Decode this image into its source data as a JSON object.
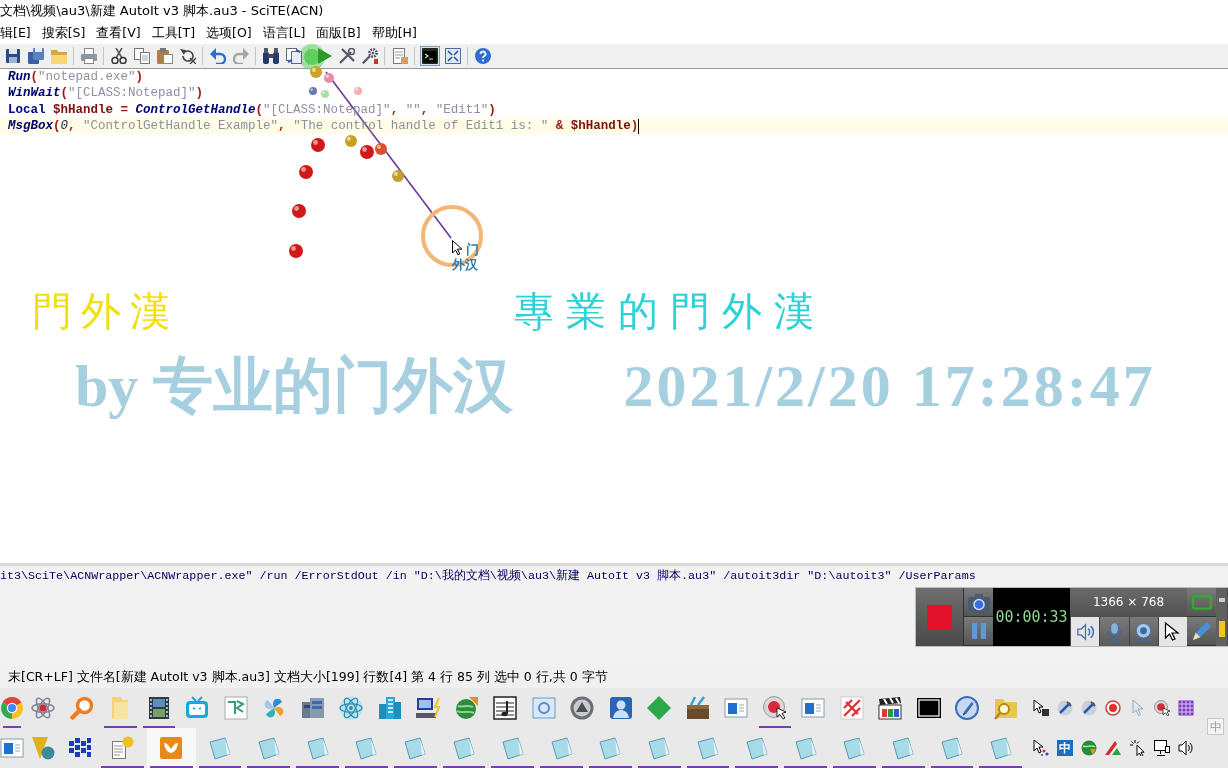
{
  "window": {
    "title": "文档\\视频\\au3\\新建 AutoIt v3 脚本.au3 - SciTE(ACN)"
  },
  "menu": [
    "辑[E]",
    "搜索[S]",
    "查看[V]",
    "工具[T]",
    "选项[O]",
    "语言[L]",
    "面版[B]",
    "帮助[H]"
  ],
  "toolbar": {
    "groups": [
      [
        {
          "kind": "save",
          "pressed": false,
          "disabled": false
        },
        {
          "kind": "saveall",
          "pressed": false,
          "disabled": false
        },
        {
          "kind": "open",
          "pressed": false,
          "disabled": false
        }
      ],
      [
        {
          "kind": "print",
          "pressed": false,
          "disabled": false
        }
      ],
      [
        {
          "kind": "cut",
          "pressed": false,
          "disabled": false
        },
        {
          "kind": "copy",
          "pressed": false,
          "disabled": false
        },
        {
          "kind": "paste",
          "pressed": false,
          "disabled": false
        },
        {
          "kind": "revert",
          "pressed": false,
          "disabled": false
        }
      ],
      [
        {
          "kind": "undo",
          "pressed": false,
          "disabled": false
        },
        {
          "kind": "redo",
          "pressed": false,
          "disabled": true
        }
      ],
      [
        {
          "kind": "find",
          "pressed": false,
          "disabled": false
        },
        {
          "kind": "replace",
          "pressed": false,
          "disabled": false
        }
      ],
      [
        {
          "kind": "run",
          "pressed": false,
          "disabled": false
        },
        {
          "kind": "compile",
          "pressed": false,
          "disabled": false
        },
        {
          "kind": "build",
          "pressed": false,
          "disabled": false
        }
      ],
      [
        {
          "kind": "properties",
          "pressed": false,
          "disabled": false
        }
      ],
      [
        {
          "kind": "console",
          "pressed": true,
          "disabled": false
        },
        {
          "kind": "fullscreen",
          "pressed": false,
          "disabled": false
        }
      ],
      [
        {
          "kind": "help",
          "pressed": false,
          "disabled": false
        }
      ]
    ]
  },
  "editor": {
    "lines": [
      {
        "current": false,
        "tokens": [
          {
            "kind": "func",
            "text": "Run"
          },
          {
            "kind": "op",
            "text": "("
          },
          {
            "kind": "str",
            "text": "\"notepad.exe\""
          },
          {
            "kind": "op",
            "text": ")"
          }
        ]
      },
      {
        "current": false,
        "tokens": [
          {
            "kind": "func",
            "text": "WinWait"
          },
          {
            "kind": "op",
            "text": "("
          },
          {
            "kind": "str",
            "text": "\"[CLASS:Notepad]\""
          },
          {
            "kind": "op",
            "text": ")"
          }
        ]
      },
      {
        "current": false,
        "tokens": [
          {
            "kind": "kw",
            "text": "Local "
          },
          {
            "kind": "var",
            "text": "$hHandle"
          },
          {
            "kind": "op",
            "text": " = "
          },
          {
            "kind": "func",
            "text": "ControlGetHandle"
          },
          {
            "kind": "op",
            "text": "("
          },
          {
            "kind": "str",
            "text": "\"[CLASS:Notepad]\""
          },
          {
            "kind": "op",
            "text": ", "
          },
          {
            "kind": "str",
            "text": "\"\""
          },
          {
            "kind": "op",
            "text": ", "
          },
          {
            "kind": "str",
            "text": "\"Edit1\""
          },
          {
            "kind": "op",
            "text": ")"
          }
        ]
      },
      {
        "current": true,
        "tokens": [
          {
            "kind": "func",
            "text": "MsgBox"
          },
          {
            "kind": "op",
            "text": "("
          },
          {
            "kind": "num",
            "text": "0"
          },
          {
            "kind": "op",
            "text": ", "
          },
          {
            "kind": "str",
            "text": "\"ControlGetHandle Example\""
          },
          {
            "kind": "op",
            "text": ", "
          },
          {
            "kind": "str",
            "text": "\"The control handle of Edit1 is: \""
          },
          {
            "kind": "op",
            "text": " & "
          },
          {
            "kind": "var",
            "text": "$hHandle"
          },
          {
            "kind": "op",
            "text": ")"
          }
        ]
      }
    ]
  },
  "overlay": {
    "calligraphy": [
      {
        "text": "門外漢",
        "color": "#f0e010"
      },
      {
        "text": "專業的門外漢",
        "color": "#2ed2d6"
      }
    ],
    "caption": [
      "by 专业的门外汉",
      "2021/2/20 17:28:47"
    ],
    "cursor_label": [
      "门",
      "外汉"
    ]
  },
  "output": {
    "lines": [
      "it3\\SciTe\\ACNWrapper\\ACNWrapper.exe\" /run /ErrorStdOut /in \"D:\\我的文档\\视频\\au3\\新建 AutoIt v3 脚本.au3\" /autoit3dir \"D:\\autoit3\" /UserParams"
    ]
  },
  "recorder": {
    "timer": "00:00:33",
    "resolution": "1366 × 768",
    "toggles": [
      {
        "kind": "speaker",
        "on": true
      },
      {
        "kind": "microphone",
        "on": false
      },
      {
        "kind": "webcam",
        "on": false
      },
      {
        "kind": "cursor",
        "on": true
      }
    ]
  },
  "status_bar": "末[CR+LF] 文件名[新建 AutoIt v3 脚本.au3] 文档大小[199] 行数[4] 第 4 行 85 列 选中 0 行,共 0 字节",
  "taskbar": {
    "rows": [
      {
        "apps": [
          {
            "kind": "wheel",
            "running": true,
            "active": false
          },
          {
            "kind": "orbit",
            "running": false,
            "active": false
          },
          {
            "kind": "magnifier",
            "running": false,
            "active": false
          },
          {
            "kind": "folder",
            "running": true,
            "active": false
          },
          {
            "kind": "filmstrip",
            "running": true,
            "active": false
          },
          {
            "kind": "tv",
            "running": false,
            "active": false
          },
          {
            "kind": "tile",
            "running": false,
            "active": false
          },
          {
            "kind": "pinwheel",
            "running": false,
            "active": false
          },
          {
            "kind": "servers",
            "running": false,
            "active": false
          },
          {
            "kind": "atom",
            "running": false,
            "active": false
          },
          {
            "kind": "buildings",
            "running": false,
            "active": false
          },
          {
            "kind": "computer",
            "running": false,
            "active": false
          },
          {
            "kind": "globe",
            "running": false,
            "active": false
          },
          {
            "kind": "music",
            "running": false,
            "active": false
          },
          {
            "kind": "panel",
            "running": false,
            "active": false
          },
          {
            "kind": "triangle",
            "running": false,
            "active": false
          },
          {
            "kind": "person",
            "running": false,
            "active": false
          },
          {
            "kind": "diamond",
            "running": false,
            "active": false
          },
          {
            "kind": "toolbox",
            "running": false,
            "active": false
          },
          {
            "kind": "window",
            "running": false,
            "active": false
          },
          {
            "kind": "record",
            "running": true,
            "active": false
          },
          {
            "kind": "window",
            "running": false,
            "active": false
          },
          {
            "kind": "pattern",
            "running": false,
            "active": false
          },
          {
            "kind": "clapper",
            "running": false,
            "active": false
          },
          {
            "kind": "plate",
            "running": false,
            "active": false
          },
          {
            "kind": "pen",
            "running": false,
            "active": false
          },
          {
            "kind": "searchfolder",
            "running": false,
            "active": false
          }
        ],
        "tray": [
          {
            "kind": "cursorbox"
          },
          {
            "kind": "wrench"
          },
          {
            "kind": "wrench"
          },
          {
            "kind": "target"
          },
          {
            "kind": "pointer"
          },
          {
            "kind": "record"
          },
          {
            "kind": "grid"
          }
        ]
      },
      {
        "apps": [
          {
            "kind": "window",
            "running": false,
            "active": false
          },
          {
            "kind": "wedge",
            "running": false,
            "active": false
          },
          {
            "kind": "blocks",
            "running": false,
            "active": false
          },
          {
            "kind": "helpdoc",
            "running": true,
            "active": false
          },
          {
            "kind": "chevron",
            "running": true,
            "active": true
          },
          {
            "kind": "notepad",
            "running": true,
            "active": false
          },
          {
            "kind": "notepad",
            "running": true,
            "active": false
          },
          {
            "kind": "notepad",
            "running": true,
            "active": false
          },
          {
            "kind": "notepad",
            "running": true,
            "active": false
          },
          {
            "kind": "notepad",
            "running": true,
            "active": false
          },
          {
            "kind": "notepad",
            "running": true,
            "active": false
          },
          {
            "kind": "notepad",
            "running": true,
            "active": false
          },
          {
            "kind": "notepad",
            "running": true,
            "active": false
          },
          {
            "kind": "notepad",
            "running": true,
            "active": false
          },
          {
            "kind": "notepad",
            "running": true,
            "active": false
          },
          {
            "kind": "notepad",
            "running": true,
            "active": false
          },
          {
            "kind": "notepad",
            "running": true,
            "active": false
          },
          {
            "kind": "notepad",
            "running": true,
            "active": false
          },
          {
            "kind": "notepad",
            "running": true,
            "active": false
          },
          {
            "kind": "notepad",
            "running": true,
            "active": false
          },
          {
            "kind": "notepad",
            "running": true,
            "active": false
          },
          {
            "kind": "notepad",
            "running": true,
            "active": false
          }
        ],
        "tray": [
          {
            "kind": "dots"
          },
          {
            "kind": "ime",
            "text": "中"
          },
          {
            "kind": "updown"
          },
          {
            "kind": "peak"
          },
          {
            "kind": "click"
          },
          {
            "kind": "network"
          },
          {
            "kind": "volume"
          }
        ]
      }
    ],
    "ime_corner": "中"
  }
}
